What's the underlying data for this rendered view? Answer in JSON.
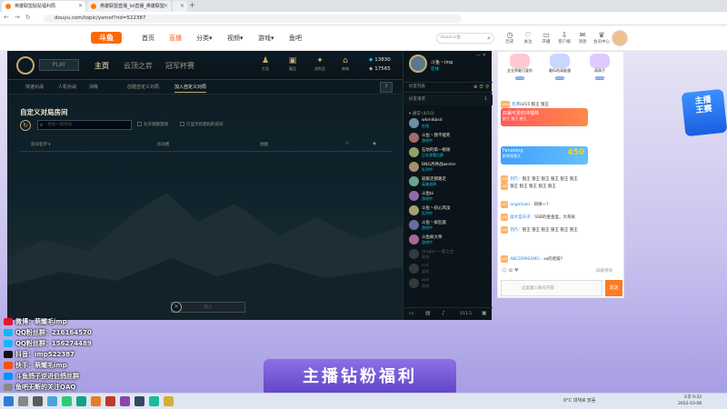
{
  "browser": {
    "tabs": [
      {
        "label": "英雄联盟贴贴福利局"
      },
      {
        "label": "英雄联盟直播_lol直播_英雄联盟"
      },
      {
        "label": "英雄联盟"
      }
    ],
    "new_tab": "+",
    "url": "douyu.com/topic/ysmof?rid=522387"
  },
  "site": {
    "logo": "斗鱼",
    "nav": [
      {
        "label": "首页"
      },
      {
        "label": "直播"
      },
      {
        "label": "分类▾"
      },
      {
        "label": "视频▾"
      },
      {
        "label": "游戏▾"
      },
      {
        "label": "鱼吧"
      }
    ],
    "search_placeholder": "Beam斗鱼",
    "header_icons": [
      {
        "label": "历史",
        "icon": "history-icon"
      },
      {
        "label": "关注",
        "icon": "follow-icon"
      },
      {
        "label": "开播",
        "icon": "broadcast-icon"
      },
      {
        "label": "客户端",
        "icon": "download-icon"
      },
      {
        "label": "消息",
        "icon": "message-icon"
      },
      {
        "label": "会员中心",
        "icon": "vip-icon"
      }
    ]
  },
  "lol": {
    "play": "PLAY",
    "nav": [
      {
        "label": "主页"
      },
      {
        "label": "云顶之弈"
      },
      {
        "label": "冠军杯赛"
      }
    ],
    "icons": [
      {
        "label": "生涯",
        "icon": "profile-icon"
      },
      {
        "label": "藏品",
        "icon": "collection-icon"
      },
      {
        "label": "战利品",
        "icon": "loot-icon"
      },
      {
        "label": "商城",
        "icon": "store-icon"
      }
    ],
    "be": "13830",
    "rp": "17565",
    "subtabs": [
      {
        "label": "快速对战"
      },
      {
        "label": "人机对战"
      },
      {
        "label": "训练"
      },
      {
        "label": "创建自定义对局"
      },
      {
        "label": "加入自定义对局"
      }
    ],
    "help": "?",
    "lobby_title": "自定义对局房间",
    "search_placeholder": "寻找一场对局",
    "chk1": "允许观察游戏",
    "chk2": "只显示有密码的房间",
    "columns": [
      "房间名字 ▾",
      "房间者",
      "地图"
    ],
    "join": "加入",
    "join_x": "✕"
  },
  "friends": {
    "name": "斗鱼丶imp",
    "status": "在线",
    "header": "好友列表",
    "sub": "好友请求",
    "sub_count": "1",
    "group": "▾ 通常 (4/10)",
    "list": [
      {
        "name": "wkmikbsd",
        "status": "在线"
      },
      {
        "name": "斗鱼丶我不能死",
        "status": "游戏中"
      },
      {
        "name": "石坊的第一根屎",
        "status": "正在观看比赛"
      },
      {
        "name": "BNG月神战winter",
        "status": "队列中"
      },
      {
        "name": "就跟走那路走",
        "status": "英雄选择"
      },
      {
        "name": "斗鱼bi",
        "status": "游戏中"
      },
      {
        "name": "斗鱼丶初心风汝",
        "status": "队列中"
      },
      {
        "name": "斗鱼丶疯狂鹿",
        "status": "游戏中"
      },
      {
        "name": "斗鱼疯大师",
        "status": "游戏中"
      },
      {
        "name": "dragon 一家之主",
        "status": "离线"
      },
      {
        "name": "ssd",
        "status": "离线"
      },
      {
        "name": "aoe",
        "status": "离线"
      }
    ],
    "version": "V11.5"
  },
  "streamer": {
    "lines": [
      {
        "label": "微博：萌耀毛imp",
        "color": "#e6162d"
      },
      {
        "label": "QQ粉丝群：216164570",
        "color": "#12b7f5"
      },
      {
        "label": "QQ粉丝群：156274489",
        "color": "#12b7f5"
      },
      {
        "label": "抖音：imp522387",
        "color": "#111111"
      },
      {
        "label": "快手：萌耀毛imp",
        "color": "#ff5000"
      },
      {
        "label": "斗鱼鸽子逆进伯鸽丝群",
        "color": "#0090ff"
      },
      {
        "label": "鱼吧无断的关注QAQ",
        "color": "#888888"
      }
    ]
  },
  "banner": "主播钻粉福利",
  "promo": "主播\n王赛",
  "right": {
    "gifts": [
      {
        "name": "全业界最可爱的",
        "badge": "LV10"
      },
      {
        "name": "最IG的高能量",
        "badge": "LV10"
      },
      {
        "name": "萌萌子",
        "badge": "LV10"
      }
    ],
    "messages": [
      {
        "lv": "LV14",
        "nick": "奶茶",
        "text": "LV15 狼王 狼王"
      },
      {
        "lv": "LV12",
        "nick": "",
        "text": "界最可爱的冲福林"
      },
      {
        "lv": "LV9",
        "nick": "Fanalong",
        "text": "影院视频大"
      },
      {
        "lv": "LV8",
        "nick": "到乃：",
        "text": "狼王 狼王 狼王 狼王 狼王 狼王"
      },
      {
        "lv": "LV8",
        "nick": "",
        "text": "狼王 狼王 狼王 狼王 狼王"
      },
      {
        "lv": "LV7",
        "nick": "angelnaki：",
        "text": "四保一?"
      },
      {
        "lv": "LV6",
        "nick": "就才是日子：",
        "text": "SSB的金金盒，大哥张"
      },
      {
        "lv": "LV5",
        "nick": "到乃：",
        "text": "狼王 狼王 狼王 狼王 狼王 狼王"
      },
      {
        "lv": "LV5",
        "nick": "ABCDSMSSMG：",
        "text": "sa的老殿?"
      }
    ],
    "ad1": "双最可爱的冲福林",
    "ad1_sub": "狼王 狼王 狼王",
    "ad2": "Fanalong",
    "ad2_sub": "影院视频大",
    "count": "450",
    "chat_placeholder": "这里输入聊天内容",
    "send": "发送",
    "block": "屏蔽特效"
  },
  "taskbar": {
    "weather": "0°C 대체로 맑음",
    "time": "오후 9:32",
    "date": "2022-03-08"
  }
}
